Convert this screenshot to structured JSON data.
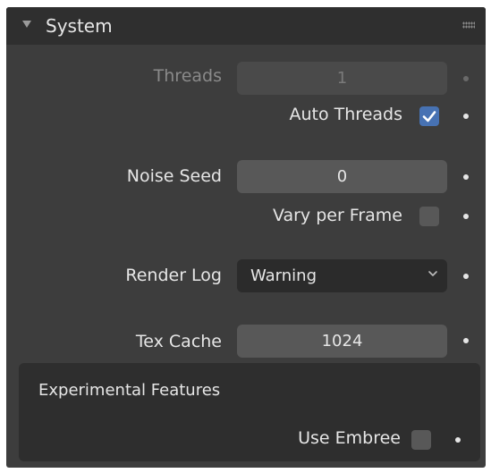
{
  "panel": {
    "title": "System",
    "icons": {
      "collapse": "triangle-down-icon",
      "drag": "drag-handle-icon"
    }
  },
  "threads": {
    "label": "Threads",
    "value": "1"
  },
  "auto_threads": {
    "label": "Auto Threads",
    "checked": true
  },
  "noise_seed": {
    "label": "Noise Seed",
    "value": "0"
  },
  "vary_per_frame": {
    "label": "Vary per Frame",
    "checked": false
  },
  "render_log": {
    "label": "Render Log",
    "value": "Warning"
  },
  "tex_cache": {
    "label": "Tex Cache",
    "value": "1024"
  },
  "experimental": {
    "title": "Experimental Features",
    "use_embree": {
      "label": "Use Embree",
      "checked": false
    }
  },
  "colors": {
    "panel_bg": "#3d3d3d",
    "header_bg": "#2f2f2f",
    "field_bg": "#585858",
    "dropdown_bg": "#2b2b2b",
    "accent": "#4772b3",
    "text": "#e6e6e6"
  }
}
